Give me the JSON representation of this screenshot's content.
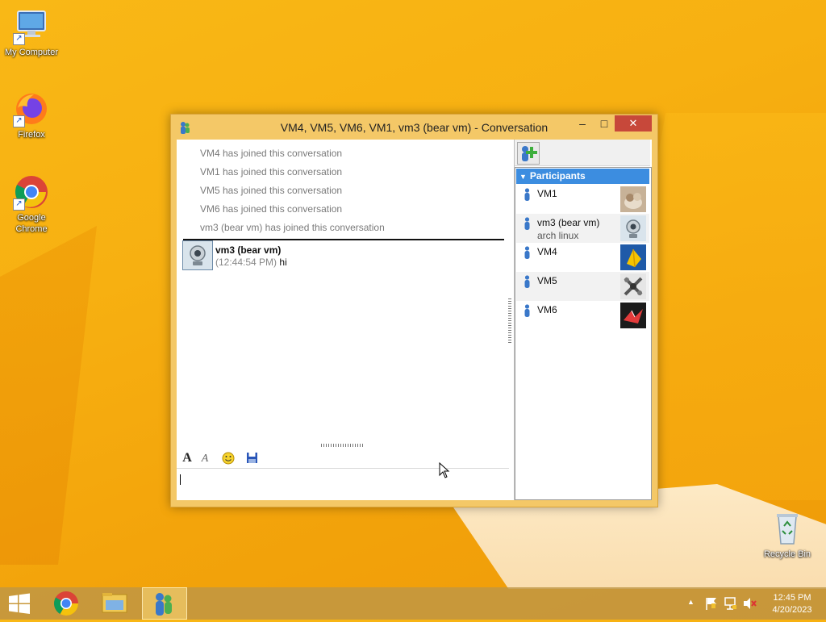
{
  "desktop": {
    "icons": [
      {
        "label": "My Computer"
      },
      {
        "label": "Firefox"
      },
      {
        "label": "Google\nChrome"
      },
      {
        "label": "Recycle Bin"
      }
    ]
  },
  "window": {
    "title": "VM4, VM5, VM6, VM1, vm3 (bear vm) - Conversation",
    "controls": {
      "minimize": "–",
      "maximize": "□",
      "close": "✕"
    }
  },
  "conversation": {
    "system_messages": [
      "VM4 has joined this conversation",
      "VM1 has joined this conversation",
      "VM5 has joined this conversation",
      "VM6 has joined this conversation",
      "vm3 (bear vm) has joined this conversation"
    ],
    "messages": [
      {
        "sender": "vm3 (bear vm)",
        "time": "(12:44:54 PM)",
        "text": "hi"
      }
    ],
    "input_value": ""
  },
  "participants": {
    "header": "Participants",
    "items": [
      {
        "name": "VM1",
        "status": ""
      },
      {
        "name": "vm3 (bear vm)",
        "status": "arch linux"
      },
      {
        "name": "VM4",
        "status": ""
      },
      {
        "name": "VM5",
        "status": ""
      },
      {
        "name": "VM6",
        "status": ""
      }
    ]
  },
  "taskbar": {
    "clock_time": "12:45 PM",
    "clock_date": "4/20/2023"
  },
  "colors": {
    "desktop_bg": "#f7b011",
    "window_frame": "#f4c867",
    "close_button": "#c7483a",
    "participants_header": "#3c8de0"
  }
}
